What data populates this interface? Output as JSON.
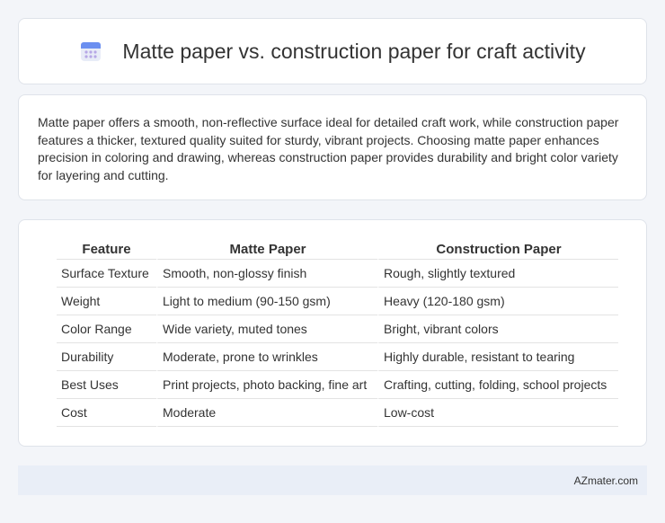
{
  "header": {
    "title": "Matte paper vs. construction paper for craft activity",
    "icon": "calendar-icon"
  },
  "description": "Matte paper offers a smooth, non-reflective surface ideal for detailed craft work, while construction paper features a thicker, textured quality suited for sturdy, vibrant projects. Choosing matte paper enhances precision in coloring and drawing, whereas construction paper provides durability and bright color variety for layering and cutting.",
  "table": {
    "headers": [
      "Feature",
      "Matte Paper",
      "Construction Paper"
    ],
    "rows": [
      [
        "Surface Texture",
        "Smooth, non-glossy finish",
        "Rough, slightly textured"
      ],
      [
        "Weight",
        "Light to medium (90-150 gsm)",
        "Heavy (120-180 gsm)"
      ],
      [
        "Color Range",
        "Wide variety, muted tones",
        "Bright, vibrant colors"
      ],
      [
        "Durability",
        "Moderate, prone to wrinkles",
        "Highly durable, resistant to tearing"
      ],
      [
        "Best Uses",
        "Print projects, photo backing, fine art",
        "Crafting, cutting, folding, school projects"
      ],
      [
        "Cost",
        "Moderate",
        "Low-cost"
      ]
    ]
  },
  "footer": {
    "brand": "AZmater.com"
  },
  "colors": {
    "background": "#f3f5f9",
    "footer_bg": "#e9eef7",
    "icon_accent": "#5b8def"
  }
}
